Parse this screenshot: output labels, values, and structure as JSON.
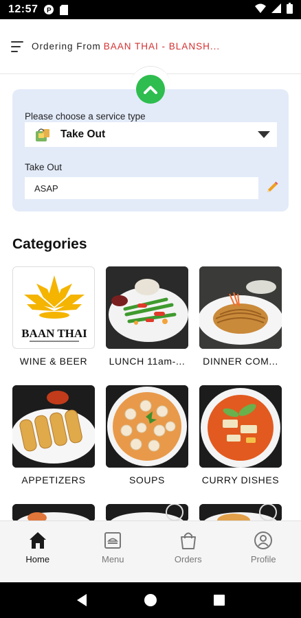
{
  "status_bar": {
    "time": "12:57"
  },
  "header": {
    "ordering_label": "Ordering From",
    "restaurant_name": "BAAN THAI - BLANSH..."
  },
  "service": {
    "prompt": "Please choose a service type",
    "selected": "Take Out",
    "time_label": "Take Out",
    "time_value": "ASAP"
  },
  "categories": {
    "title": "Categories",
    "items": [
      {
        "label": "WINE & BEER",
        "image": "baan-thai-logo",
        "logo_text": "BAAN THAI"
      },
      {
        "label": "LUNCH 11am-...",
        "image": "stir-fry-plate"
      },
      {
        "label": "DINNER COM...",
        "image": "noodle-plate"
      },
      {
        "label": "APPETIZERS",
        "image": "spring-rolls"
      },
      {
        "label": "SOUPS",
        "image": "mushroom-soup"
      },
      {
        "label": "CURRY DISHES",
        "image": "curry-bowl"
      },
      {
        "label": "",
        "image": "dish-partial"
      },
      {
        "label": "",
        "image": "dish-partial"
      },
      {
        "label": "",
        "image": "dish-partial"
      }
    ]
  },
  "tabs": [
    {
      "label": "Home",
      "icon": "home-icon",
      "active": true
    },
    {
      "label": "Menu",
      "icon": "menu-icon",
      "active": false
    },
    {
      "label": "Orders",
      "icon": "bag-icon",
      "active": false
    },
    {
      "label": "Profile",
      "icon": "profile-icon",
      "active": false
    }
  ],
  "colors": {
    "accent": "#2ebd4e",
    "brand_red": "#d32f2f",
    "panel": "#e3ebf9"
  }
}
